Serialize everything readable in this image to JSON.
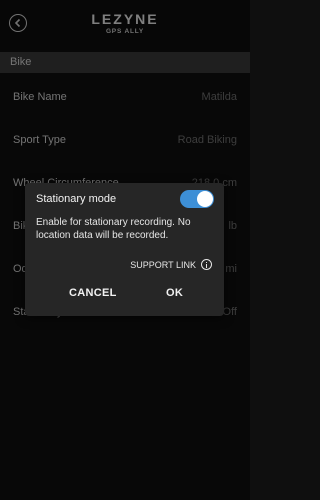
{
  "header": {
    "logo_main": "LEZYNE",
    "logo_sub": "GPS ALLY",
    "back_icon": "back-arrow-circle-icon"
  },
  "section": {
    "title": "Bike"
  },
  "rows": [
    {
      "label": "Bike Name",
      "value": "Matilda"
    },
    {
      "label": "Sport Type",
      "value": "Road Biking"
    },
    {
      "label": "Wheel Circumference",
      "value": "218.0 cm"
    },
    {
      "label": "Bike Weight",
      "value": "lb"
    },
    {
      "label": "Odometer",
      "value": "mi"
    },
    {
      "label": "Stationary Mode",
      "value": "Off"
    }
  ],
  "dialog": {
    "title": "Stationary mode",
    "toggle_on": true,
    "description": "Enable for stationary recording. No location data will be recorded.",
    "support_link": "SUPPORT LINK",
    "cancel_label": "CANCEL",
    "ok_label": "OK"
  },
  "colors": {
    "background": "#0f0f0f",
    "section_header": "#3a3a3a",
    "dialog_bg": "#262626",
    "toggle_accent": "#3d8fd6",
    "value_text": "#6f6f6f"
  }
}
